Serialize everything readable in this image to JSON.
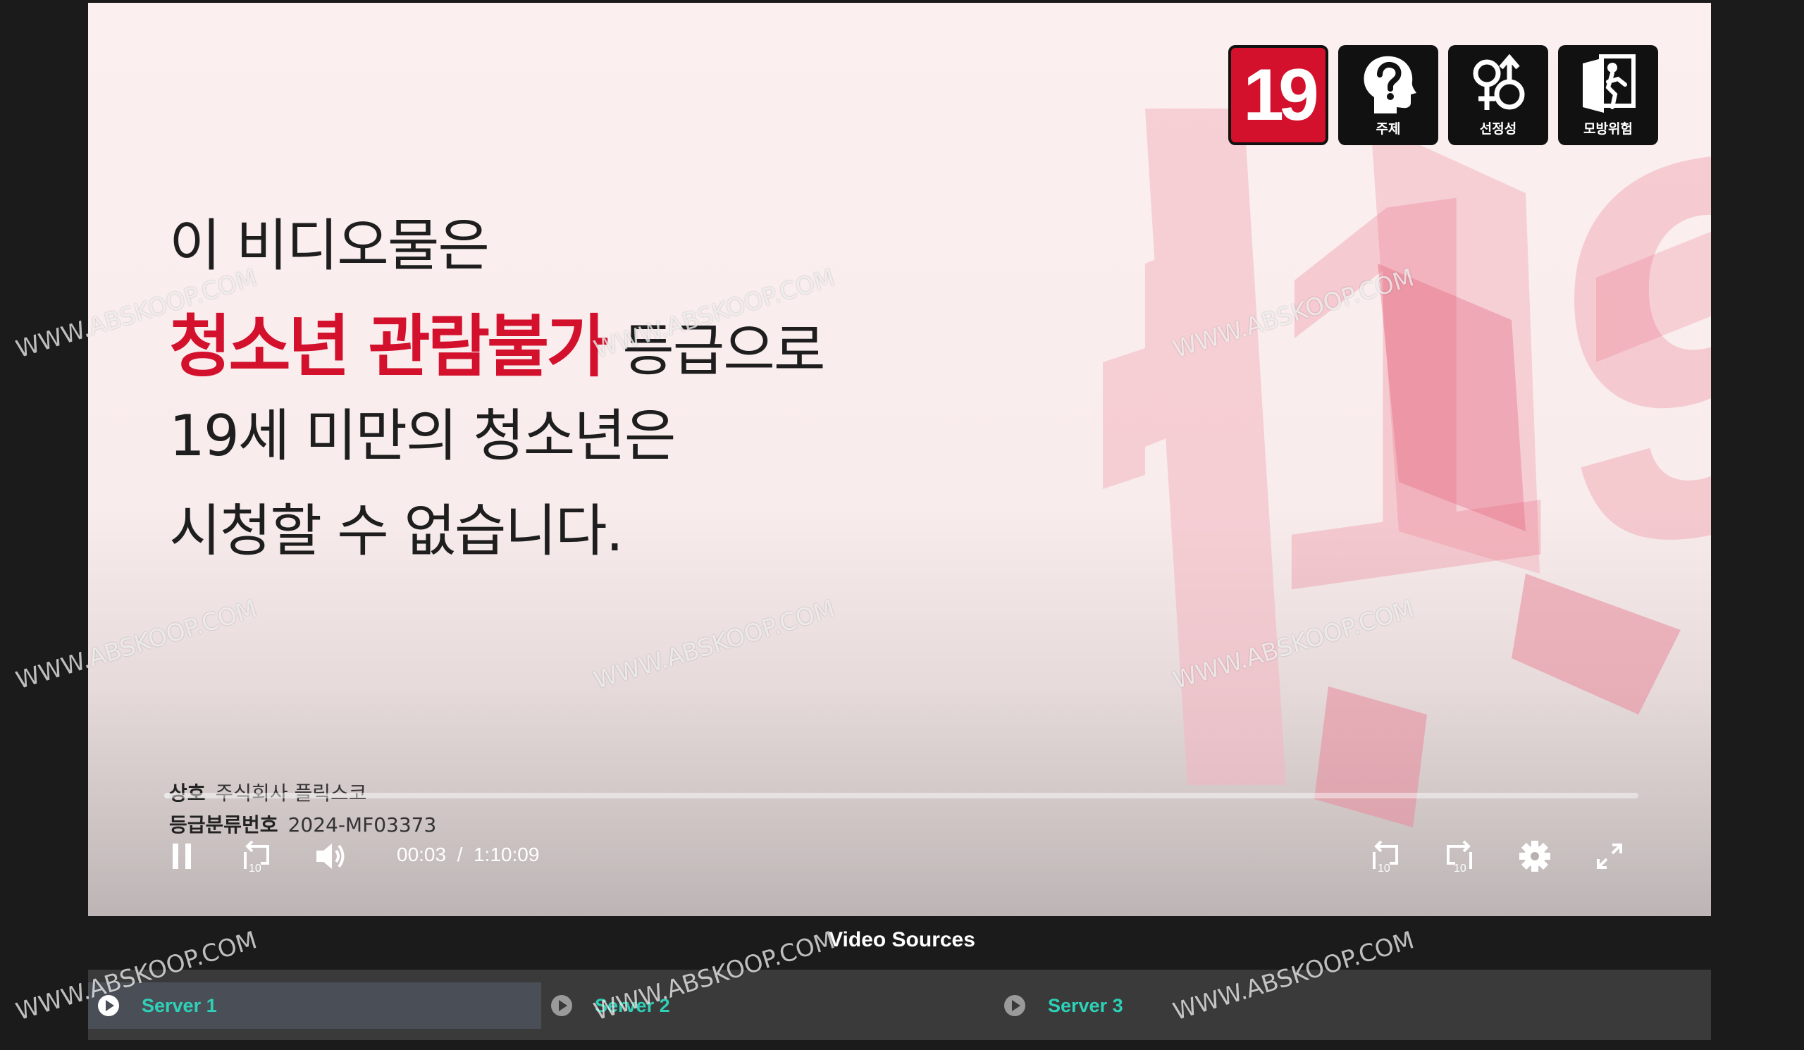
{
  "rating_badges": [
    {
      "label": "19",
      "caption": ""
    },
    {
      "label": "",
      "caption": "주제"
    },
    {
      "label": "",
      "caption": "선정성"
    },
    {
      "label": "",
      "caption": "모방위험"
    }
  ],
  "background_numeral": "19",
  "notice": {
    "line1": "이 비디오물은",
    "line2_highlight": "청소년 관람불가",
    "line2_rest": " 등급으로",
    "line3": "19세 미만의 청소년은",
    "line4": "시청할 수 없습니다."
  },
  "company": {
    "name_key": "상호",
    "name_value": "주식회사 플릭스코",
    "rating_key": "등급분류번호",
    "rating_value": "2024-MF03373"
  },
  "player": {
    "current_time": "00:03",
    "separator": "/",
    "duration": "1:10:09",
    "progress_fraction": 0.001,
    "rewind_label": "10",
    "forward_label": "10"
  },
  "video_sources": {
    "title": "Video Sources",
    "servers": [
      "Server 1",
      "Server 2",
      "Server 3"
    ],
    "active_index": 0
  },
  "watermark_text": "WWW.ABSKOOP.COM",
  "colors": {
    "accent_red": "#d3112d",
    "server_label": "#2ed1b8"
  }
}
